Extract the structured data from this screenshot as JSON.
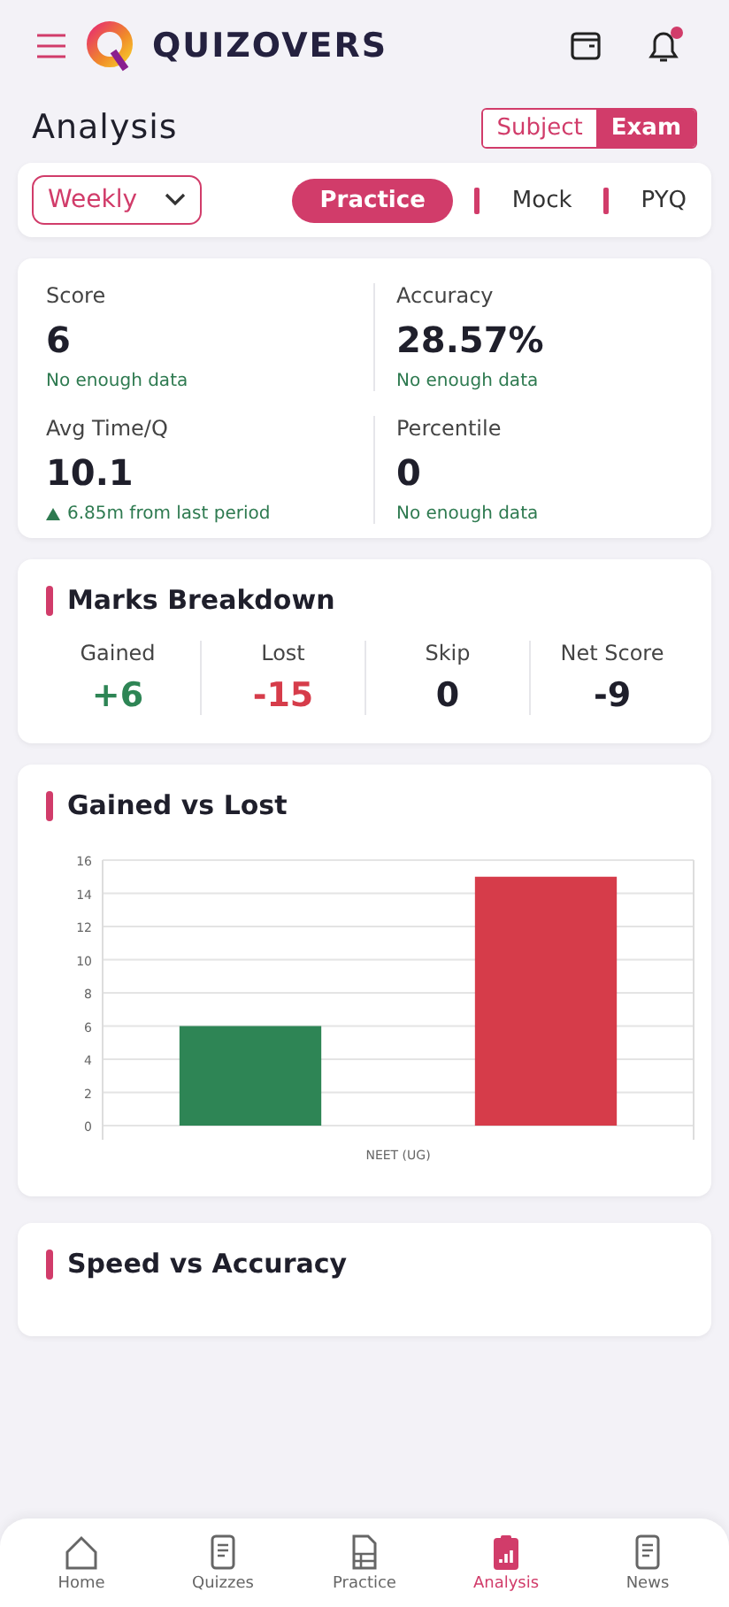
{
  "header": {
    "brand": "QUIZOVERS",
    "notification_badge": true
  },
  "page_title": "Analysis",
  "view_toggle": [
    {
      "label": "Subject",
      "selected": false
    },
    {
      "label": "Exam",
      "selected": true
    }
  ],
  "period_select": {
    "value": "Weekly"
  },
  "mode_tabs": [
    {
      "label": "Practice",
      "selected": true
    },
    {
      "label": "Mock",
      "selected": false
    },
    {
      "label": "PYQ",
      "selected": false
    }
  ],
  "stats": [
    {
      "label": "Score",
      "value": "6",
      "note": "No enough data",
      "kind": "plain"
    },
    {
      "label": "Accuracy",
      "value": "28.57%",
      "note": "No enough data",
      "kind": "plain"
    },
    {
      "label": "Avg Time/Q",
      "value": "10.1",
      "note": "6.85m from last period",
      "kind": "up"
    },
    {
      "label": "Percentile",
      "value": "0",
      "note": "No enough data",
      "kind": "plain"
    }
  ],
  "marks_breakdown": {
    "title": "Marks Breakdown",
    "items": [
      {
        "label": "Gained",
        "value": "+6",
        "color": "#2e8555"
      },
      {
        "label": "Lost",
        "value": "-15",
        "color": "#d63c4a"
      },
      {
        "label": "Skip",
        "value": "0",
        "color": "#1f1f2b"
      },
      {
        "label": "Net Score",
        "value": "-9",
        "color": "#1f1f2b"
      }
    ]
  },
  "gained_vs_lost": {
    "title": "Gained vs Lost",
    "chart_data": {
      "type": "bar",
      "categories": [
        "NEET (UG)"
      ],
      "series": [
        {
          "color": "#2e8555",
          "values": [
            6
          ]
        },
        {
          "color": "#d63c4a",
          "values": [
            15
          ]
        }
      ],
      "ylim": [
        0,
        16
      ],
      "grid": true,
      "yticks": [
        0,
        2,
        4,
        6,
        8,
        10,
        12,
        14,
        16
      ]
    }
  },
  "speed_vs_accuracy": {
    "title": "Speed vs Accuracy"
  },
  "bottom_nav": [
    {
      "label": "Home",
      "kind": "home",
      "selected": false
    },
    {
      "label": "Quizzes",
      "kind": "doc",
      "selected": false
    },
    {
      "label": "Practice",
      "kind": "sheet",
      "selected": false
    },
    {
      "label": "Analysis",
      "kind": "clipboard",
      "selected": true
    },
    {
      "label": "News",
      "kind": "doc",
      "selected": false
    }
  ]
}
